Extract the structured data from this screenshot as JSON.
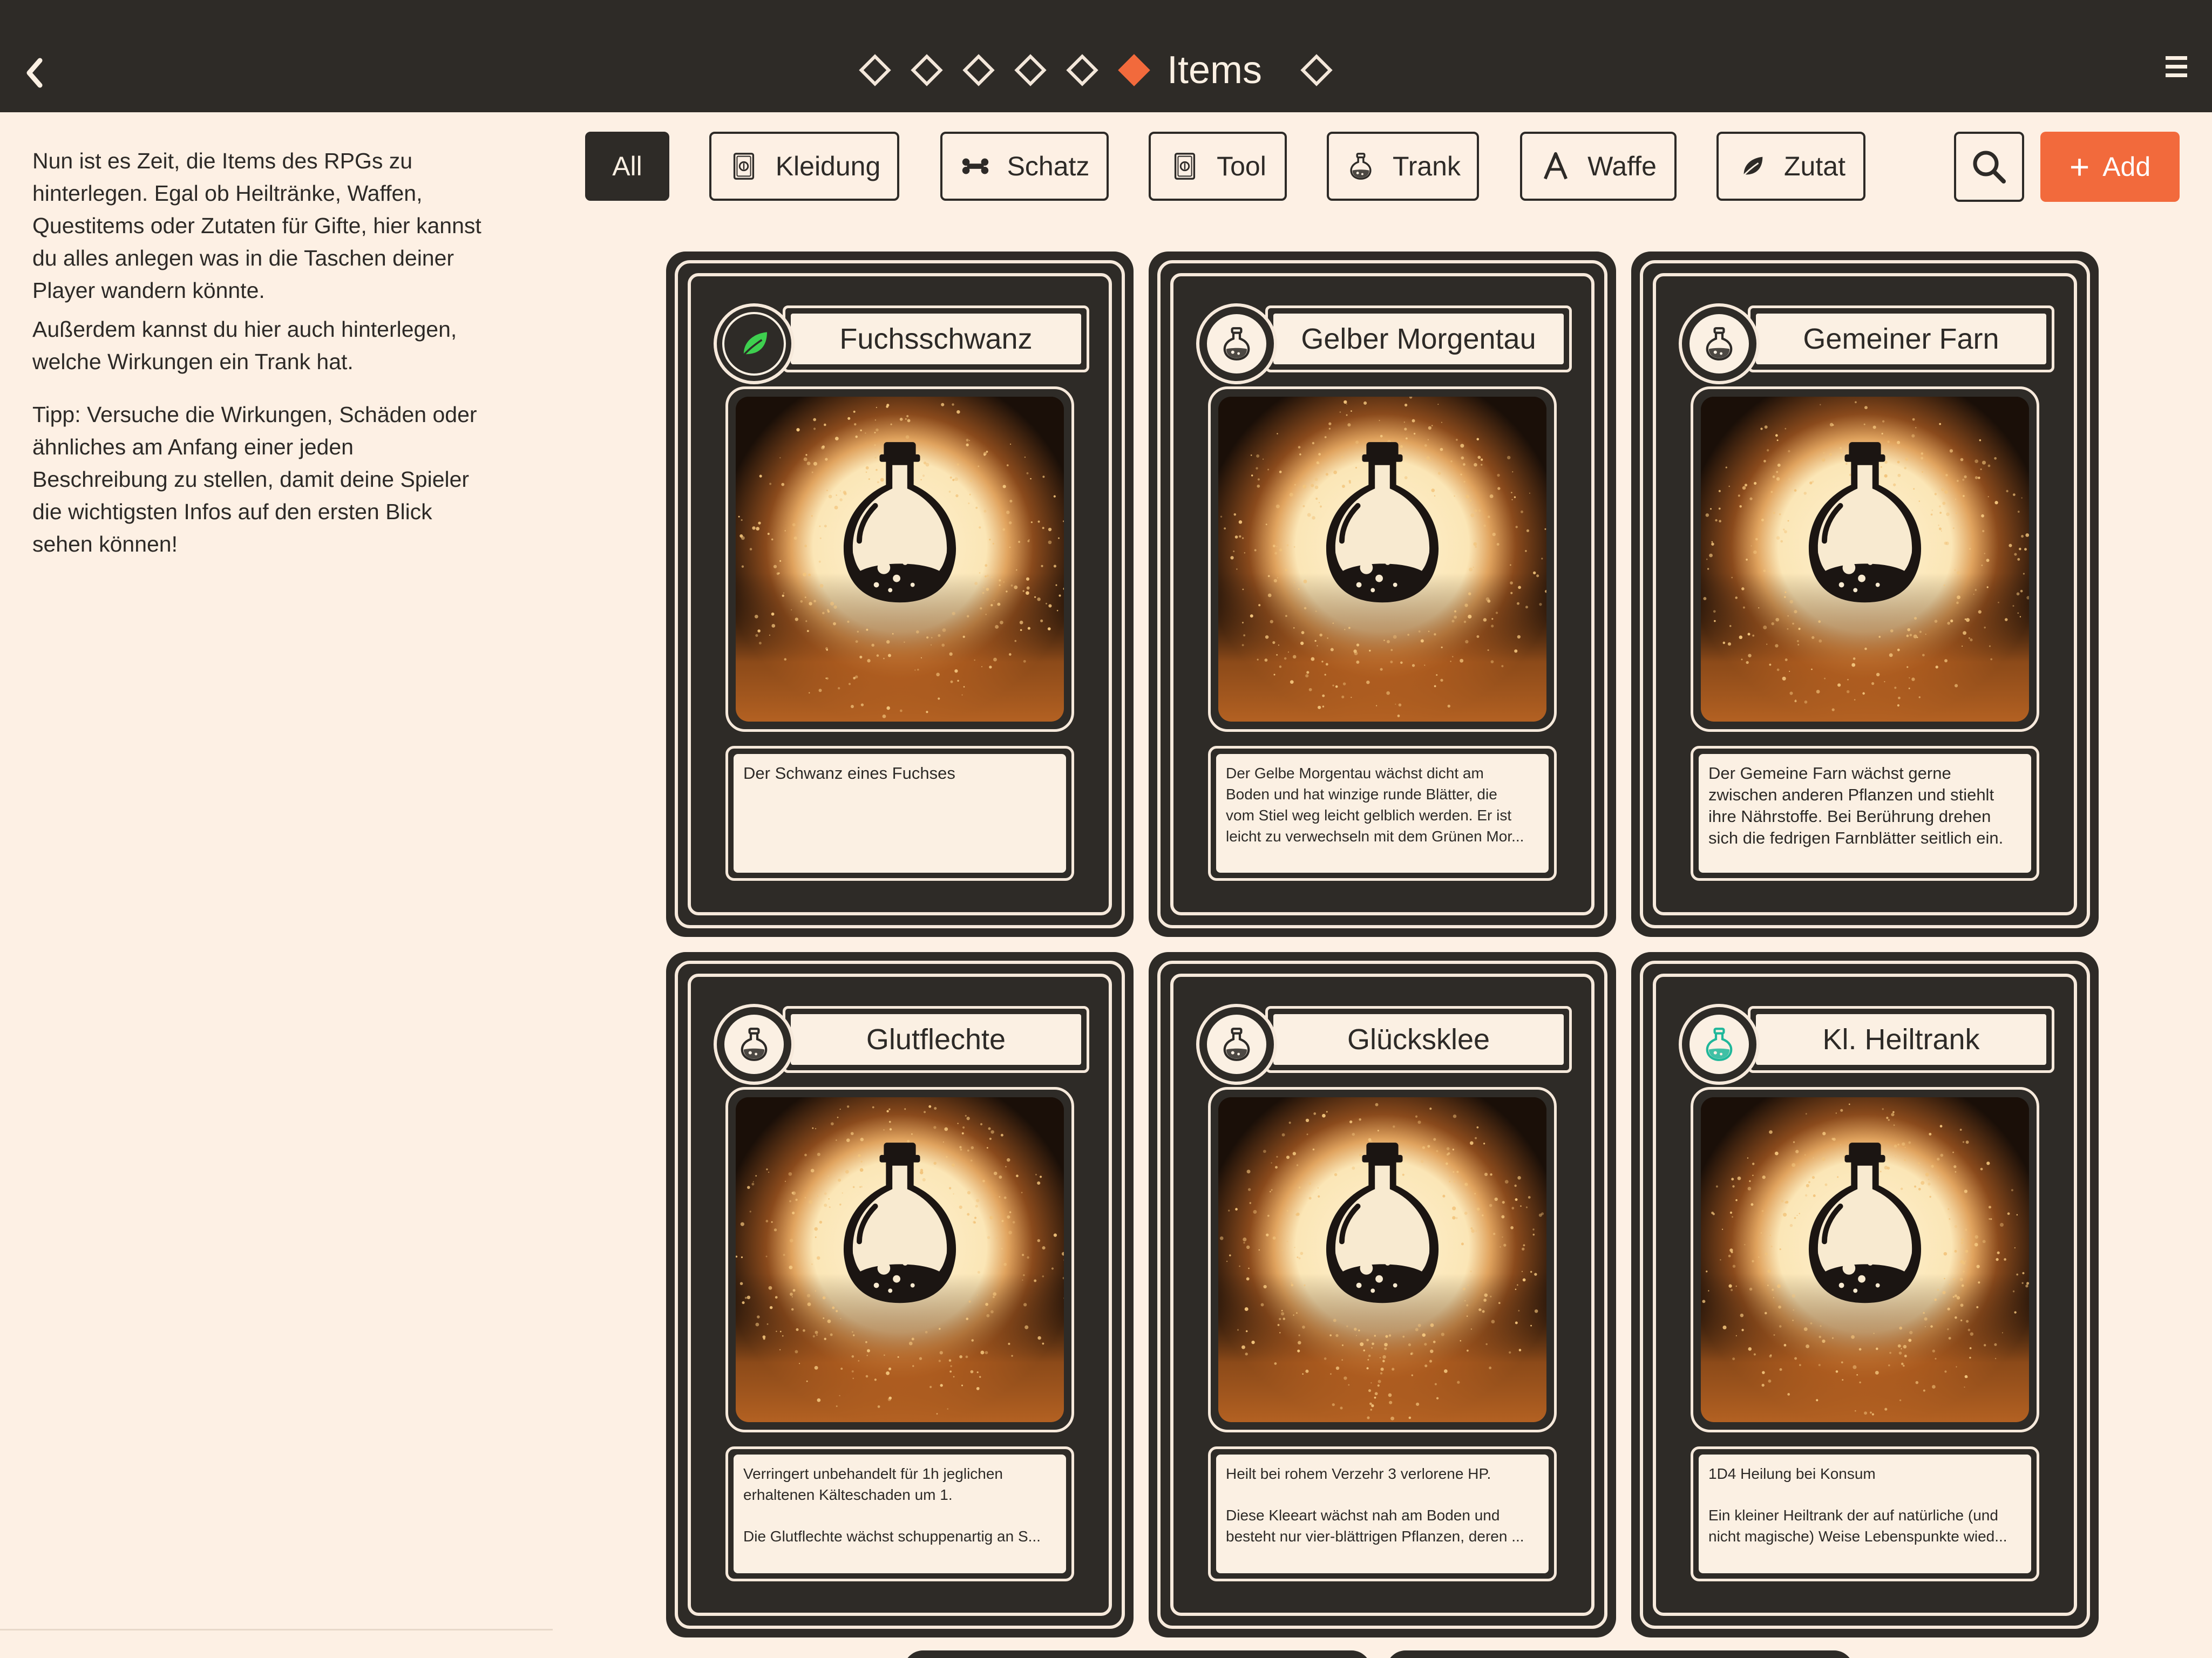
{
  "header": {
    "title": "Items",
    "steps_before": 5,
    "steps_after": 1,
    "accent": "#f26a3c",
    "bar_color": "#2e2b27"
  },
  "sidebar": {
    "paragraphs": [
      [
        "Nun ist es Zeit, die Items des RPGs zu",
        "hinterlegen. Egal ob Heiltränke, Waffen,",
        "Questitems oder Zutaten für Gifte, hier kannst",
        "du alles anlegen was in die Taschen deiner",
        "Player wandern könnte."
      ],
      [
        "Außerdem kannst du hier auch hinterlegen,",
        "welche Wirkungen ein Trank hat."
      ],
      [
        "Tipp: Versuche die Wirkungen, Schäden oder",
        "ähnliches am Anfang einer jeden",
        "Beschreibung zu stellen, damit deine Spieler",
        "die wichtigsten Infos auf den ersten Blick",
        "sehen können!"
      ]
    ]
  },
  "filters": [
    {
      "label": "All",
      "icon": "none",
      "active": true
    },
    {
      "label": "Kleidung",
      "icon": "coin-card-icon",
      "active": false
    },
    {
      "label": "Schatz",
      "icon": "bone-icon",
      "active": false
    },
    {
      "label": "Tool",
      "icon": "coin-card-icon",
      "active": false
    },
    {
      "label": "Trank",
      "icon": "potion-icon",
      "active": false
    },
    {
      "label": "Waffe",
      "icon": "letter-a-icon",
      "active": false
    },
    {
      "label": "Zutat",
      "icon": "leaf-icon",
      "active": false
    }
  ],
  "actions": {
    "add_label": "Add",
    "search_icon": "search-icon"
  },
  "cards": [
    {
      "title": "Fuchsschwanz",
      "icon": "leaf-icon",
      "icon_color": "#3ecf4f",
      "desc": [
        [
          "Der Schwanz eines Fuchses"
        ]
      ],
      "small": false
    },
    {
      "title": "Gelber Morgentau",
      "icon": "potion-icon",
      "icon_color": "#2d2a27",
      "desc": [
        [
          "Der Gelbe Morgentau wächst dicht am",
          "Boden und hat winzige runde Blätter, die",
          "vom Stiel weg leicht gelblich werden. Er ist",
          "leicht zu verwechseln mit dem Grünen Mor..."
        ]
      ],
      "small": true
    },
    {
      "title": "Gemeiner Farn",
      "icon": "potion-icon",
      "icon_color": "#2d2a27",
      "desc": [
        [
          "Der Gemeine Farn wächst gerne",
          "zwischen anderen Pflanzen und stiehlt",
          "ihre Nährstoffe. Bei Berührung drehen",
          "sich die fedrigen Farnblätter seitlich ein."
        ]
      ],
      "small": false
    },
    {
      "title": "Glutflechte",
      "icon": "potion-icon",
      "icon_color": "#2d2a27",
      "desc": [
        [
          "Verringert unbehandelt für 1h jeglichen",
          "erhaltenen Kälteschaden um 1."
        ],
        [
          "Die Glutflechte wächst schuppenartig an S..."
        ]
      ],
      "small": true
    },
    {
      "title": "Glücksklee",
      "icon": "potion-icon",
      "icon_color": "#2d2a27",
      "desc": [
        [
          "Heilt bei rohem Verzehr 3 verlorene HP."
        ],
        [
          "Diese Kleeart wächst nah am Boden und",
          "besteht nur vier-blättrigen Pflanzen, deren ..."
        ]
      ],
      "small": true
    },
    {
      "title": "Kl. Heiltrank",
      "icon": "potion-icon",
      "icon_color": "#1fb79a",
      "desc": [
        [
          "1D4 Heilung bei Konsum"
        ],
        [
          "Ein kleiner Heiltrank der auf natürliche (und",
          "nicht magische) Weise Lebenspunkte wied..."
        ]
      ],
      "small": true
    }
  ]
}
